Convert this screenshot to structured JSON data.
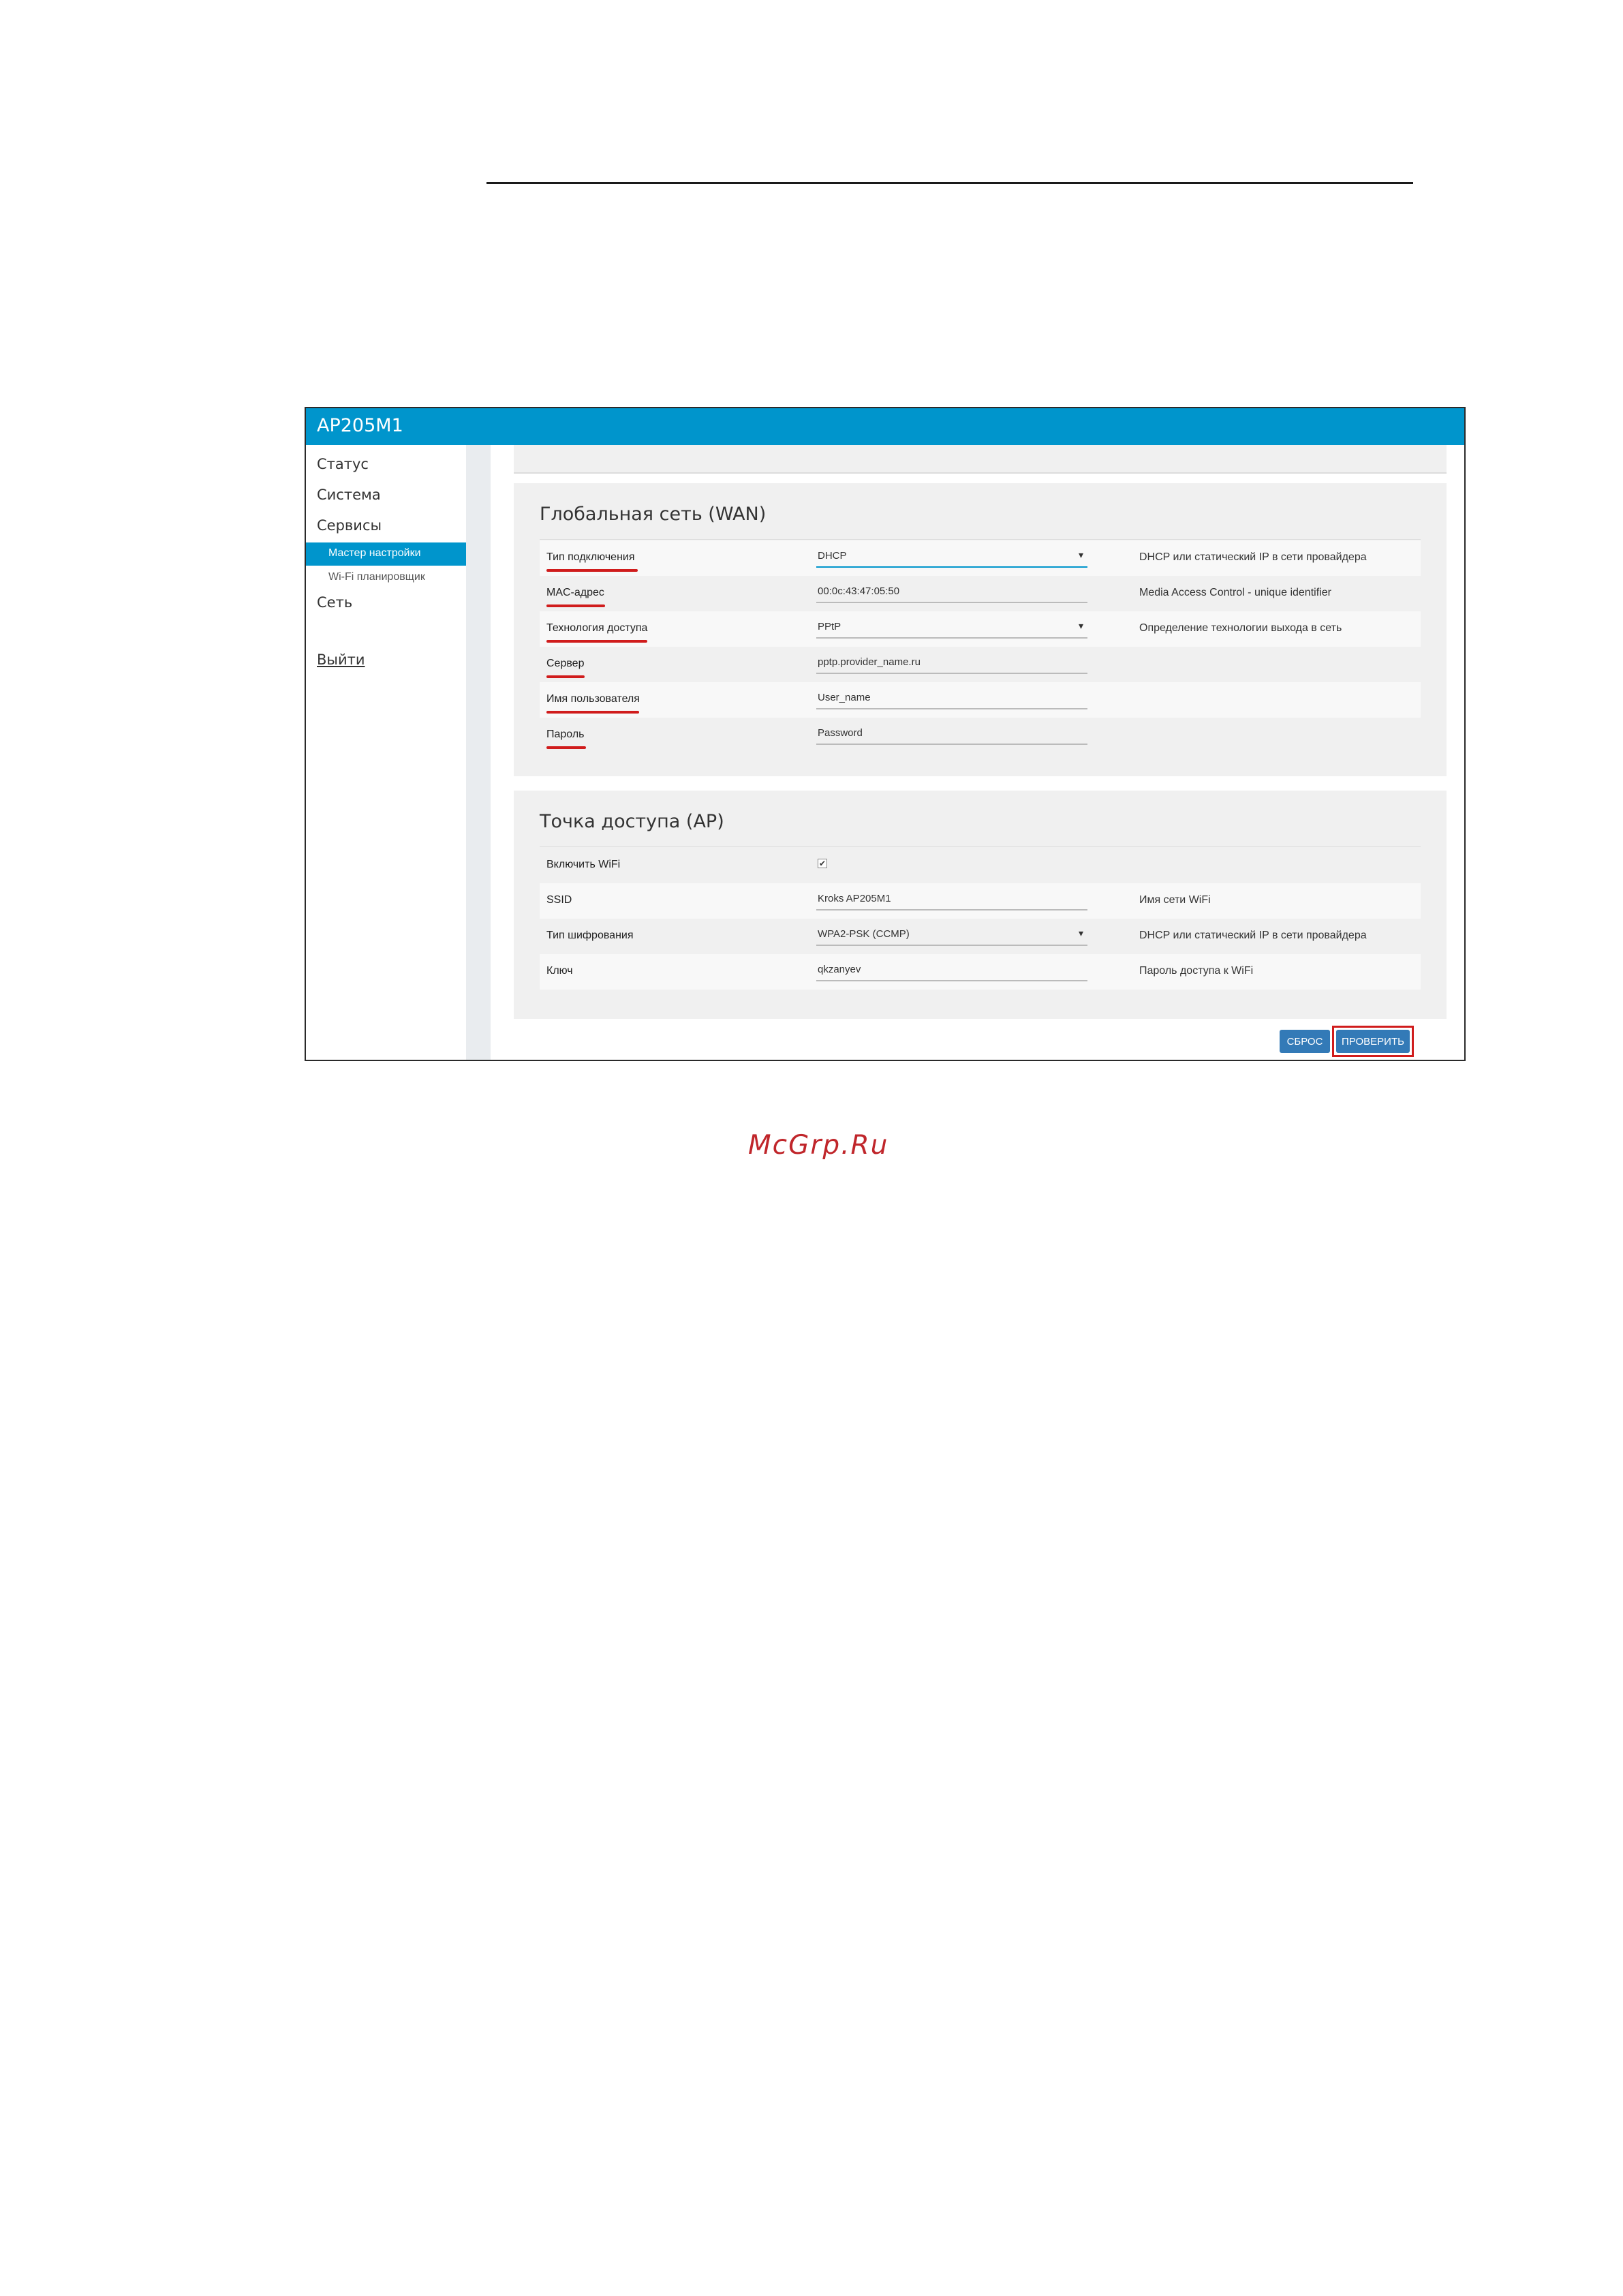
{
  "app": {
    "title": "AP205M1"
  },
  "sidebar": {
    "items": [
      {
        "label": "Статус"
      },
      {
        "label": "Система"
      },
      {
        "label": "Сервисы"
      },
      {
        "label": "Сеть"
      }
    ],
    "subitems": [
      {
        "label": "Мастер настройки",
        "active": true
      },
      {
        "label": "Wi-Fi планировщик",
        "active": false
      }
    ],
    "logout": "Выйти"
  },
  "wan": {
    "title": "Глобальная сеть (WAN)",
    "rows": [
      {
        "label": "Тип подключения",
        "value": "DHCP",
        "desc": "DHCP или статический IP в сети провайдера"
      },
      {
        "label": "MAC-адрес",
        "value": "00:0c:43:47:05:50",
        "desc": "Media Access Control - unique identifier"
      },
      {
        "label": "Технология доступа",
        "value": "PPtP",
        "desc": "Определение технологии выхода в сеть"
      },
      {
        "label": "Сервер",
        "value": "pptp.provider_name.ru",
        "desc": ""
      },
      {
        "label": "Имя пользователя",
        "value": "User_name",
        "desc": ""
      },
      {
        "label": "Пароль",
        "value": "Password",
        "desc": ""
      }
    ]
  },
  "ap": {
    "title": "Точка доступа (AP)",
    "rows": [
      {
        "label": "Включить WiFi",
        "value": "✔",
        "desc": ""
      },
      {
        "label": "SSID",
        "value": "Kroks AP205M1",
        "desc": "Имя сети WiFi"
      },
      {
        "label": "Тип шифрования",
        "value": "WPA2-PSK (CCMP)",
        "desc": "DHCP или статический IP в сети провайдера"
      },
      {
        "label": "Ключ",
        "value": "qkzanyev",
        "desc": "Пароль доступа к WiFi"
      }
    ]
  },
  "buttons": {
    "reset": "СБРОС",
    "check": "ПРОВЕРИТЬ"
  },
  "icons": {
    "dropdown": "▾",
    "checkbox_checked": "✔"
  },
  "watermark": "McGrp.Ru",
  "colors": {
    "accent": "#0095cc",
    "button": "#337ab7",
    "highlight": "#d01c1c"
  }
}
